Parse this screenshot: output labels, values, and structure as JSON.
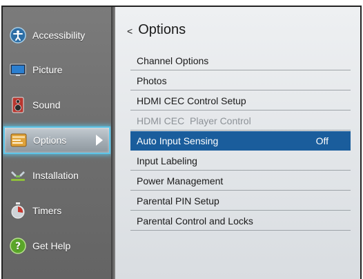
{
  "sidebar": {
    "items": [
      {
        "label": "Accessibility",
        "icon": "accessibility-icon"
      },
      {
        "label": "Picture",
        "icon": "picture-icon"
      },
      {
        "label": "Sound",
        "icon": "sound-icon"
      },
      {
        "label": "Options",
        "icon": "options-icon",
        "selected": true
      },
      {
        "label": "Installation",
        "icon": "installation-icon"
      },
      {
        "label": "Timers",
        "icon": "timers-icon"
      },
      {
        "label": "Get Help",
        "icon": "get-help-icon"
      }
    ]
  },
  "header": {
    "back_glyph": "<",
    "title": "Options"
  },
  "options": {
    "items": [
      {
        "label": "Channel Options",
        "value": ""
      },
      {
        "label": "Photos",
        "value": ""
      },
      {
        "label": "HDMI CEC Control Setup",
        "value": ""
      },
      {
        "label": "HDMI CEC  Player Control",
        "value": "",
        "disabled": true
      },
      {
        "label": "Auto Input Sensing",
        "value": "Off",
        "highlighted": true
      },
      {
        "label": "Input Labeling",
        "value": ""
      },
      {
        "label": "Power Management",
        "value": ""
      },
      {
        "label": "Parental PIN Setup",
        "value": ""
      },
      {
        "label": "Parental Control and Locks",
        "value": ""
      }
    ]
  },
  "colors": {
    "highlight": "#1a5d9c",
    "focus_glow": "#5ec5e8",
    "sidebar": "#6e6e6e"
  }
}
